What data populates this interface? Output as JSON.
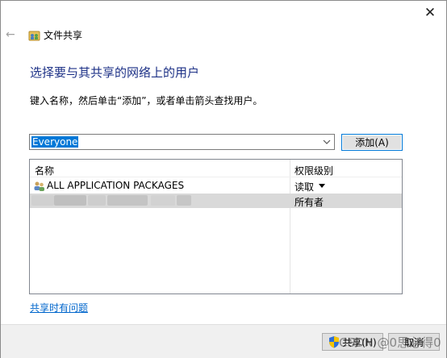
{
  "window": {
    "close_glyph": "✕",
    "back_glyph": "←",
    "title": "文件共享"
  },
  "main": {
    "heading": "选择要与其共享的网络上的用户",
    "instruction": "键入名称，然后单击“添加”，或者单击箭头查找用户。",
    "combo_value": "Everyone",
    "add_button": "添加(A)"
  },
  "list": {
    "columns": [
      "名称",
      "权限级别"
    ],
    "rows": [
      {
        "name": "ALL APPLICATION PACKAGES",
        "permission": "读取",
        "icon": "group-users-icon"
      },
      {
        "name": "",
        "permission": "所有者",
        "icon": ""
      }
    ]
  },
  "help_link": "共享时有问题",
  "footer": {
    "share_button": "共享(H)",
    "cancel_button": "取消"
  },
  "watermark": "CSDN @0思必得0",
  "colors": {
    "heading": "#1e3287",
    "selection": "#0078d7",
    "link": "#0066cc",
    "selected_row": "#d9d9d9",
    "footer_bg": "#f0f0f0"
  }
}
